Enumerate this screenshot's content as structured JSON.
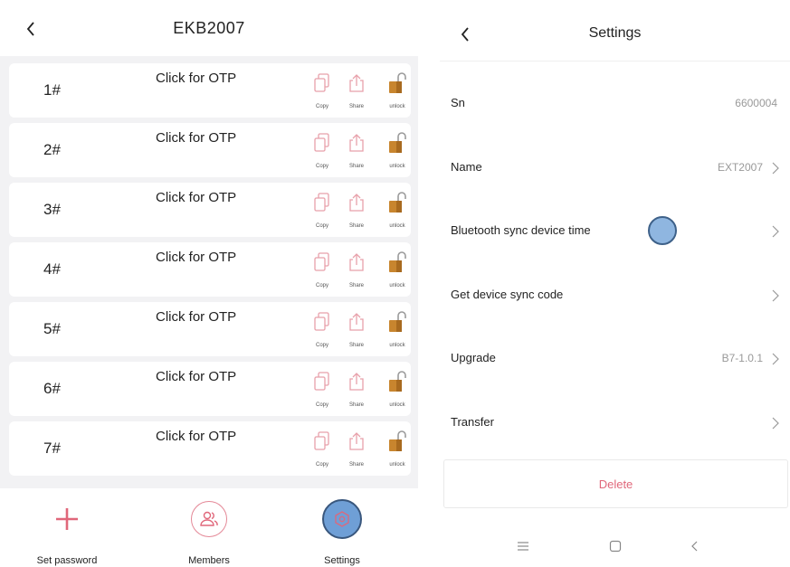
{
  "left": {
    "title": "EKB2007",
    "back_icon": "chevron-left-icon",
    "locks": [
      {
        "number": "1#",
        "otp_label": "Click for OTP"
      },
      {
        "number": "2#",
        "otp_label": "Click for OTP"
      },
      {
        "number": "3#",
        "otp_label": "Click for OTP"
      },
      {
        "number": "4#",
        "otp_label": "Click for OTP"
      },
      {
        "number": "5#",
        "otp_label": "Click for OTP"
      },
      {
        "number": "6#",
        "otp_label": "Click for OTP"
      },
      {
        "number": "7#",
        "otp_label": "Click for OTP"
      }
    ],
    "actions": {
      "copy": "Copy",
      "share": "Share",
      "unlock": "unlock"
    },
    "tabs": {
      "set_password": "Set password",
      "members": "Members",
      "settings": "Settings"
    }
  },
  "right": {
    "title": "Settings",
    "rows": [
      {
        "label": "Sn",
        "value": "6600004",
        "has_chevron": false
      },
      {
        "label": "Name",
        "value": "EXT2007",
        "has_chevron": true
      },
      {
        "label": "Bluetooth sync device time",
        "value": "",
        "has_chevron": true
      },
      {
        "label": "Get device sync code",
        "value": "",
        "has_chevron": true
      },
      {
        "label": "Upgrade",
        "value": "B7-1.0.1",
        "has_chevron": true
      },
      {
        "label": "Transfer",
        "value": "",
        "has_chevron": true
      }
    ],
    "delete_label": "Delete"
  },
  "colors": {
    "accent_red": "#e0677a",
    "icon_pink": "#e8a0aa",
    "lock_orange": "#c8852e",
    "tap_highlight": "#6f9fd6",
    "background_gray": "#f2f2f4"
  }
}
